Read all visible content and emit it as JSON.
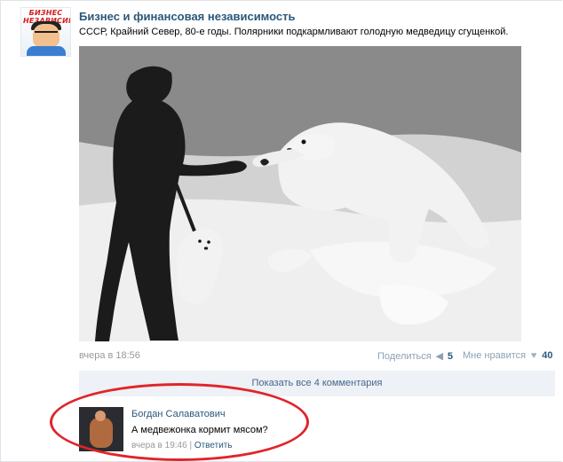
{
  "post": {
    "author": "Бизнес и финансовая независимость",
    "logo_text": "БИЗНЕС\nНЕЗАВИСИМОСТЬ",
    "text": "СССР, Крайний Север, 80-е годы. Полярники подкармливают голодную медведицу сгущенкой.",
    "time": "вчера в 18:56",
    "share_label": "Поделиться",
    "share_count": "5",
    "like_label": "Мне нравится",
    "like_count": "40",
    "show_all": "Показать все 4 комментария"
  },
  "comment": {
    "author": "Богдан Салаватович",
    "text": "А медвежонка кормит мясом?",
    "time": "вчера в 19:46",
    "reply": "Ответить"
  },
  "colors": {
    "link": "#2b587a",
    "highlight": "#e0242a"
  }
}
